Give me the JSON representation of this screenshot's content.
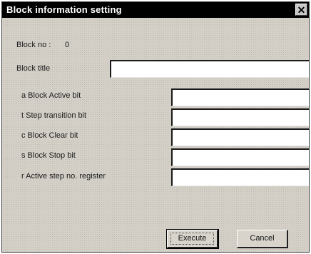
{
  "window": {
    "title": "Block information setting",
    "close_glyph": "✕"
  },
  "block": {
    "no_label": "Block no :",
    "no_value": "0",
    "title_label": "Block title",
    "title_value": ""
  },
  "fields": [
    {
      "label": "a Block Active bit",
      "value": ""
    },
    {
      "label": "t Step transition bit",
      "value": ""
    },
    {
      "label": "c Block Clear bit",
      "value": ""
    },
    {
      "label": "s Block Stop bit",
      "value": ""
    },
    {
      "label": "r Active step no. register",
      "value": ""
    }
  ],
  "buttons": {
    "execute": "Execute",
    "cancel": "Cancel"
  }
}
